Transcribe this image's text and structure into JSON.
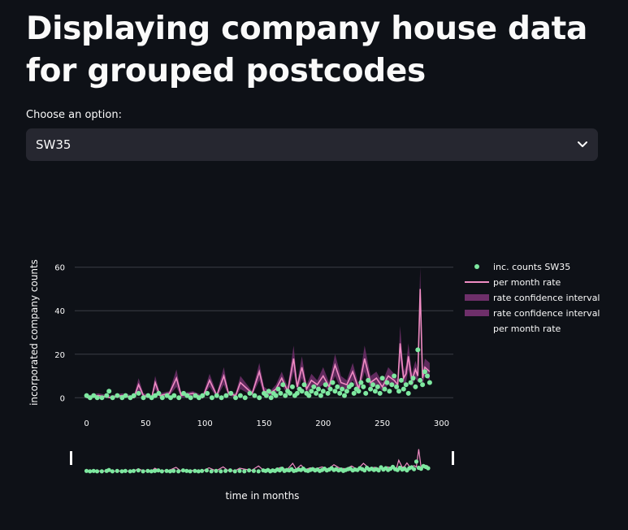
{
  "page": {
    "title": "Displaying company house data for grouped postcodes",
    "select_label": "Choose an option:",
    "select_value": "SW35"
  },
  "colors": {
    "background": "#0e1117",
    "select_bg": "#262730",
    "points": "#7ee8a0",
    "rate_line": "#f08cc4",
    "ci_fill": "#6e2f6a",
    "grid": "#3a3d47"
  },
  "chart_data": {
    "type": "scatter",
    "title": "",
    "xlabel": "time in months",
    "ylabel": "incorporated company counts",
    "xlim": [
      -10,
      310
    ],
    "ylim": [
      -4,
      64
    ],
    "x_ticks": [
      0,
      50,
      100,
      150,
      200,
      250,
      300
    ],
    "y_ticks": [
      0,
      20,
      40,
      60
    ],
    "grid": true,
    "legend_position": "right",
    "legend": [
      {
        "label": "inc. counts SW35",
        "kind": "marker"
      },
      {
        "label": "per month rate",
        "kind": "line"
      },
      {
        "label": "rate confidence interval",
        "kind": "band"
      },
      {
        "label": "rate confidence interval",
        "kind": "band"
      },
      {
        "label": "per month rate",
        "kind": "none"
      }
    ],
    "series": [
      {
        "name": "inc. counts SW35",
        "kind": "points",
        "x": [
          0,
          3,
          6,
          9,
          13,
          17,
          19,
          22,
          26,
          30,
          33,
          37,
          40,
          44,
          48,
          52,
          55,
          58,
          61,
          64,
          68,
          71,
          74,
          78,
          82,
          85,
          88,
          92,
          95,
          98,
          102,
          106,
          110,
          114,
          118,
          122,
          126,
          130,
          134,
          138,
          142,
          146,
          150,
          152,
          154,
          156,
          158,
          160,
          162,
          164,
          166,
          168,
          170,
          172,
          174,
          176,
          178,
          180,
          182,
          184,
          186,
          188,
          190,
          192,
          194,
          196,
          198,
          200,
          202,
          204,
          206,
          208,
          210,
          212,
          214,
          216,
          218,
          220,
          222,
          224,
          226,
          228,
          230,
          232,
          234,
          236,
          238,
          240,
          242,
          244,
          246,
          248,
          250,
          252,
          254,
          256,
          258,
          260,
          262,
          264,
          266,
          268,
          270,
          272,
          274,
          276,
          278,
          280,
          282,
          284,
          286,
          288,
          290
        ],
        "y": [
          1,
          0,
          1,
          0,
          0,
          1,
          3,
          0,
          1,
          0,
          1,
          0,
          1,
          2,
          0,
          1,
          0,
          1,
          2,
          0,
          1,
          0,
          1,
          0,
          2,
          1,
          0,
          1,
          0,
          1,
          2,
          0,
          1,
          0,
          1,
          2,
          0,
          1,
          0,
          2,
          1,
          0,
          2,
          1,
          3,
          0,
          2,
          1,
          4,
          2,
          6,
          1,
          3,
          2,
          5,
          1,
          2,
          4,
          3,
          6,
          2,
          1,
          3,
          5,
          2,
          4,
          1,
          3,
          6,
          2,
          4,
          7,
          3,
          5,
          2,
          4,
          1,
          3,
          5,
          6,
          2,
          4,
          3,
          7,
          5,
          2,
          8,
          4,
          6,
          3,
          5,
          2,
          9,
          4,
          7,
          3,
          6,
          10,
          5,
          3,
          8,
          4,
          6,
          2,
          7,
          9,
          5,
          22,
          8,
          6,
          12,
          10,
          7
        ],
        "color": "#7ee8a0"
      },
      {
        "name": "per month rate",
        "kind": "line",
        "x": [
          0,
          10,
          20,
          30,
          40,
          44,
          48,
          55,
          58,
          62,
          70,
          76,
          80,
          90,
          98,
          104,
          110,
          116,
          120,
          126,
          130,
          140,
          146,
          150,
          155,
          160,
          165,
          170,
          175,
          178,
          182,
          186,
          190,
          195,
          200,
          205,
          210,
          215,
          220,
          225,
          230,
          235,
          240,
          245,
          250,
          255,
          260,
          263,
          265,
          268,
          270,
          272,
          275,
          278,
          280,
          282,
          284,
          286,
          290
        ],
        "y": [
          0,
          1,
          0,
          1,
          0,
          6,
          1,
          0,
          7,
          1,
          2,
          9,
          1,
          2,
          0,
          8,
          1,
          10,
          2,
          1,
          7,
          2,
          12,
          3,
          2,
          4,
          9,
          3,
          18,
          5,
          14,
          4,
          8,
          6,
          10,
          5,
          15,
          7,
          6,
          12,
          4,
          18,
          7,
          9,
          5,
          10,
          8,
          6,
          25,
          9,
          11,
          19,
          8,
          13,
          10,
          50,
          9,
          14,
          12
        ],
        "color": "#f08cc4"
      },
      {
        "name": "rate confidence interval",
        "kind": "band",
        "x": [
          0,
          10,
          20,
          30,
          40,
          44,
          48,
          55,
          58,
          62,
          70,
          76,
          80,
          90,
          98,
          104,
          110,
          116,
          120,
          126,
          130,
          140,
          146,
          150,
          155,
          160,
          165,
          170,
          175,
          178,
          182,
          186,
          190,
          195,
          200,
          205,
          210,
          215,
          220,
          225,
          230,
          235,
          240,
          245,
          250,
          255,
          260,
          263,
          265,
          268,
          270,
          272,
          275,
          278,
          280,
          282,
          284,
          286,
          290
        ],
        "upper": [
          1,
          2,
          1,
          2,
          1,
          9,
          2,
          1,
          10,
          2,
          3,
          13,
          2,
          3,
          1,
          11,
          2,
          14,
          3,
          2,
          10,
          3,
          16,
          5,
          3,
          6,
          12,
          5,
          24,
          7,
          19,
          6,
          11,
          8,
          14,
          7,
          20,
          10,
          8,
          16,
          6,
          24,
          10,
          12,
          7,
          14,
          11,
          8,
          33,
          12,
          15,
          25,
          11,
          17,
          13,
          60,
          12,
          18,
          16
        ],
        "lower": [
          0,
          0,
          0,
          0,
          0,
          3,
          0,
          0,
          4,
          0,
          1,
          5,
          0,
          1,
          0,
          5,
          0,
          6,
          1,
          0,
          4,
          1,
          8,
          1,
          1,
          2,
          6,
          1,
          12,
          3,
          9,
          2,
          5,
          4,
          6,
          3,
          10,
          4,
          4,
          8,
          2,
          12,
          4,
          6,
          3,
          6,
          5,
          4,
          17,
          6,
          7,
          13,
          5,
          9,
          7,
          40,
          6,
          10,
          8
        ],
        "color": "#6e2f6a"
      }
    ]
  }
}
